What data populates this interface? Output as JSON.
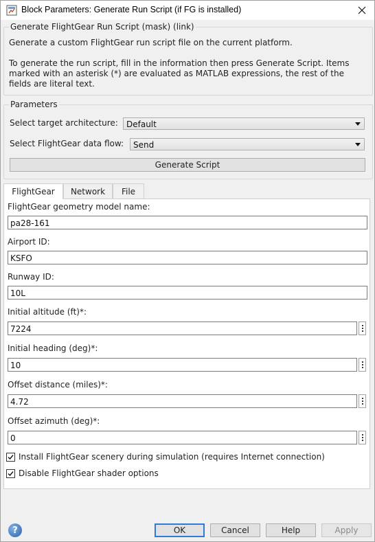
{
  "window": {
    "title": "Block Parameters: Generate Run Script (if FG is installed)"
  },
  "mask": {
    "heading": "Generate FlightGear Run Script (mask) (link)",
    "description_1": "Generate a custom FlightGear run script file on the current platform.",
    "description_2_line1": "To generate the run script, fill in the information then press Generate Script.  Items",
    "description_2_line2": "marked with an asterisk (*) are evaluated as MATLAB expressions, the rest of the",
    "description_2_line3": "fields are literal text."
  },
  "parameters": {
    "legend": "Parameters",
    "target_label": "Select target architecture:",
    "target_value": "Default",
    "dataflow_label": "Select FlightGear data flow:",
    "dataflow_value": "Send",
    "generate_button": "Generate Script"
  },
  "tabs": [
    {
      "label": "FlightGear",
      "active": true
    },
    {
      "label": "Network",
      "active": false
    },
    {
      "label": "File",
      "active": false
    }
  ],
  "fields": {
    "geometry_label": "FlightGear geometry model name:",
    "geometry_value": "pa28-161",
    "airport_label": "Airport ID:",
    "airport_value": "KSFO",
    "runway_label": "Runway ID:",
    "runway_value": "10L",
    "altitude_label": "Initial altitude (ft)*:",
    "altitude_value": "7224",
    "heading_label": "Initial heading (deg)*:",
    "heading_value": "10",
    "offset_distance_label": "Offset distance (miles)*:",
    "offset_distance_value": "4.72",
    "offset_azimuth_label": "Offset azimuth (deg)*:",
    "offset_azimuth_value": "0"
  },
  "checkboxes": {
    "install_scenery_label": "Install FlightGear scenery during simulation (requires Internet connection)",
    "install_scenery_checked": true,
    "disable_shader_label": "Disable FlightGear shader options",
    "disable_shader_checked": true
  },
  "buttons": {
    "ok": "OK",
    "cancel": "Cancel",
    "help": "Help",
    "apply": "Apply",
    "help_icon_glyph": "?"
  },
  "colors": {
    "default_button_border": "#2f7ad6",
    "help_icon": "#2f62a8"
  }
}
